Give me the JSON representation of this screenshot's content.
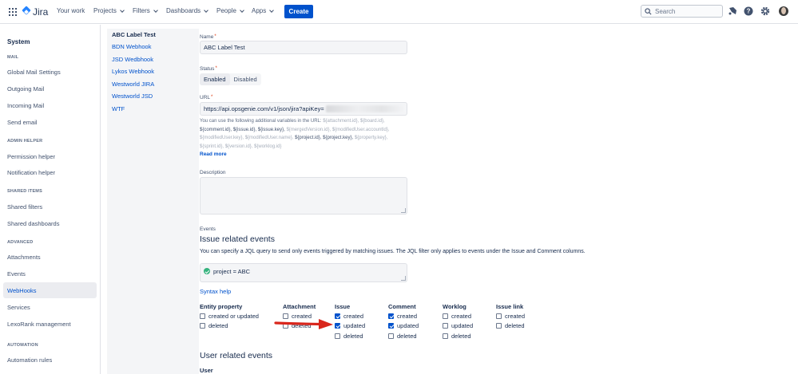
{
  "topnav": {
    "product": "Jira",
    "items": [
      {
        "label": "Your work",
        "dropdown": false
      },
      {
        "label": "Projects",
        "dropdown": true
      },
      {
        "label": "Filters",
        "dropdown": true
      },
      {
        "label": "Dashboards",
        "dropdown": true
      },
      {
        "label": "People",
        "dropdown": true
      },
      {
        "label": "Apps",
        "dropdown": true
      }
    ],
    "create_label": "Create",
    "search_placeholder": "Search",
    "icons": [
      "notifications-icon",
      "help-icon",
      "settings-icon",
      "avatar"
    ]
  },
  "sidebar": {
    "title": "System",
    "sections": [
      {
        "heading": "MAIL",
        "items": [
          "Global Mail Settings",
          "Outgoing Mail",
          "Incoming Mail",
          "Send email"
        ]
      },
      {
        "heading": "ADMIN HELPER",
        "items": [
          "Permission helper",
          "Notification helper"
        ]
      },
      {
        "heading": "SHARED ITEMS",
        "items": [
          "Shared filters",
          "Shared dashboards"
        ]
      },
      {
        "heading": "ADVANCED",
        "items": [
          "Attachments",
          "Events",
          "WebHooks",
          "Services",
          "LexoRank management"
        ]
      },
      {
        "heading": "AUTOMATION",
        "items": [
          "Automation rules"
        ]
      }
    ],
    "active_item": "WebHooks"
  },
  "webhooks": {
    "items": [
      "ABC Label Test",
      "BDN Webhook",
      "JSD Wedbhook",
      "Lykos Webhook",
      "Westworld JIRA",
      "Westworld JSD",
      "WTF"
    ],
    "selected": "ABC Label Test"
  },
  "form": {
    "name_label": "Name",
    "name_value": "ABC Label Test",
    "status_label": "Status",
    "status_enabled": "Enabled",
    "status_disabled": "Disabled",
    "url_label": "URL",
    "url_value": "https://api.opsgenie.com/v1/json/jira?apiKey=",
    "help_prefix": "You can use the following additional variables in the URL:",
    "help_vars": [
      {
        "t": "${attachment.id},",
        "d": false
      },
      {
        "t": "${board.id},",
        "d": false
      },
      {
        "t": "${comment.id},",
        "d": true
      },
      {
        "t": "${issue.id},",
        "d": true
      },
      {
        "t": "${issue.key},",
        "d": true
      },
      {
        "t": "${mergedVersion.id},",
        "d": false
      },
      {
        "t": "${modifiedUser.accountId},",
        "d": false
      },
      {
        "t": "${modifiedUser.key},",
        "d": false
      },
      {
        "t": "${modifiedUser.name},",
        "d": false
      },
      {
        "t": "${project.id},",
        "d": true
      },
      {
        "t": "${project.key},",
        "d": true
      },
      {
        "t": "${property.key},",
        "d": false
      },
      {
        "t": "${sprint.id},",
        "d": false
      },
      {
        "t": "${version.id},",
        "d": false
      },
      {
        "t": "${worklog.id}",
        "d": false
      }
    ],
    "read_more": "Read more",
    "description_label": "Description",
    "events_label": "Events",
    "issue_events_heading": "Issue related events",
    "issue_events_desc": "You can specify a JQL query to send only events triggered by matching issues. The JQL filter only applies to events under the Issue and Comment columns.",
    "jql_value": "project = ABC",
    "syntax_help": "Syntax help",
    "user_events_heading": "User related events",
    "user_sub": "User"
  },
  "event_columns": [
    {
      "title": "Entity property",
      "options": [
        {
          "label": "created or updated",
          "checked": false
        },
        {
          "label": "deleted",
          "checked": false
        }
      ]
    },
    {
      "title": "Attachment",
      "options": [
        {
          "label": "created",
          "checked": false
        },
        {
          "label": "deleted",
          "checked": false
        }
      ]
    },
    {
      "title": "Issue",
      "options": [
        {
          "label": "created",
          "checked": true
        },
        {
          "label": "updated",
          "checked": true
        },
        {
          "label": "deleted",
          "checked": false
        }
      ]
    },
    {
      "title": "Comment",
      "options": [
        {
          "label": "created",
          "checked": true
        },
        {
          "label": "updated",
          "checked": true
        },
        {
          "label": "deleted",
          "checked": false
        }
      ]
    },
    {
      "title": "Worklog",
      "options": [
        {
          "label": "created",
          "checked": false
        },
        {
          "label": "updated",
          "checked": false
        },
        {
          "label": "deleted",
          "checked": false
        }
      ]
    },
    {
      "title": "Issue link",
      "options": [
        {
          "label": "created",
          "checked": false
        },
        {
          "label": "deleted",
          "checked": false
        }
      ]
    }
  ],
  "colors": {
    "accent": "#0052cc",
    "annotation_arrow": "#d9261c"
  }
}
